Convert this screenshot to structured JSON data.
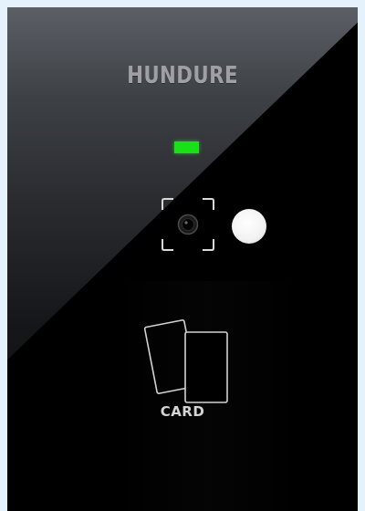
{
  "device": {
    "brand": "HUNDURE",
    "card_label": "CARD",
    "status_led_color": "#1ae01a",
    "icons": {
      "camera": "camera-lens-icon",
      "sensor": "sensor-dot-icon",
      "card": "card-reader-icon"
    }
  }
}
